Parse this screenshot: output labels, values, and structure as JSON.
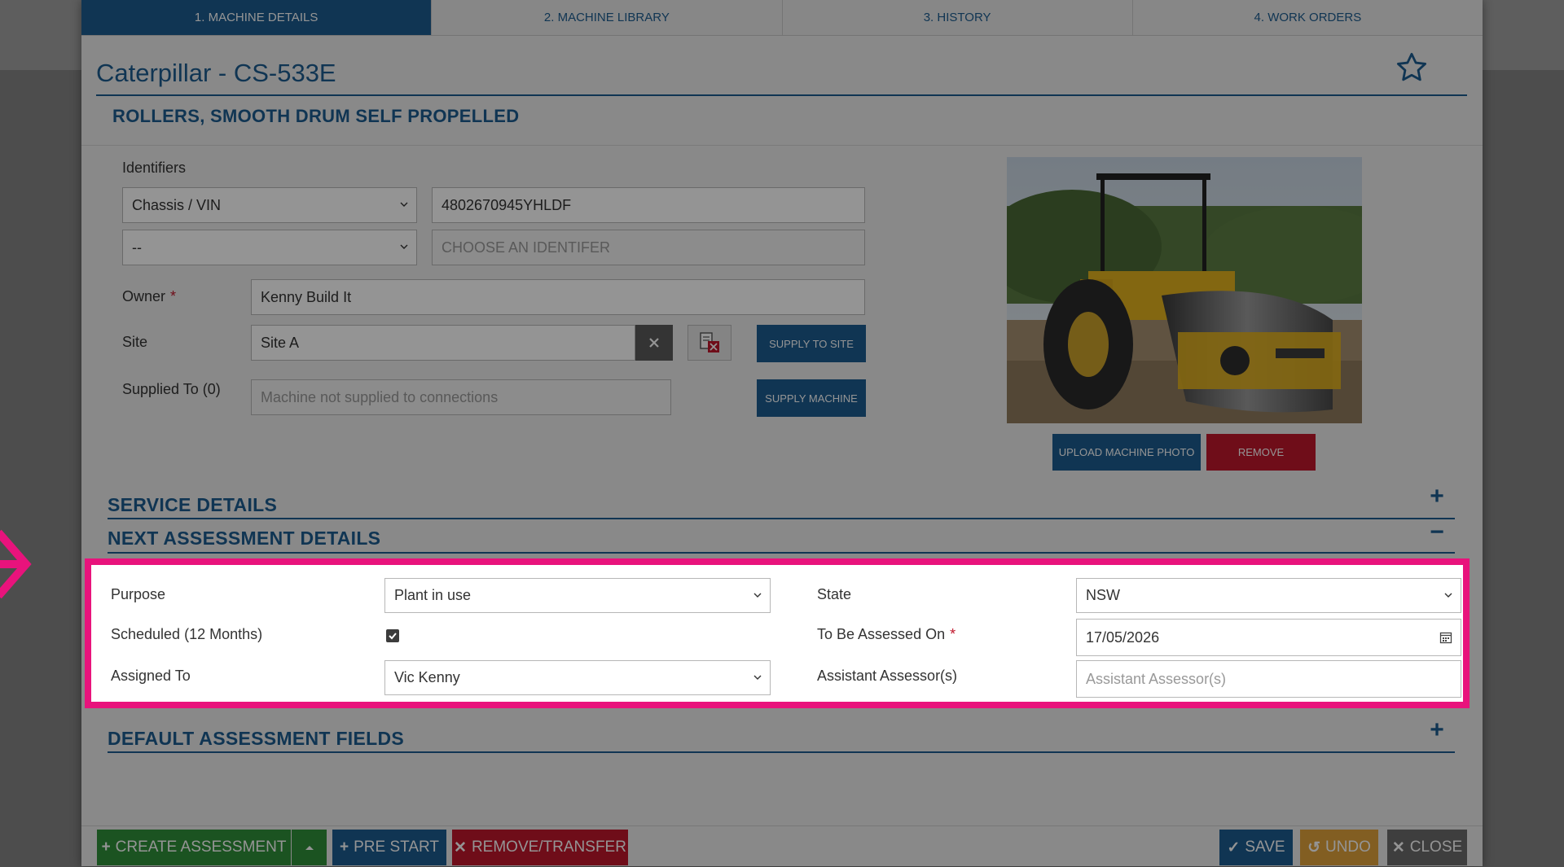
{
  "tabs": [
    {
      "label": "1. MACHINE DETAILS",
      "active": true
    },
    {
      "label": "2. MACHINE LIBRARY",
      "active": false
    },
    {
      "label": "3. HISTORY",
      "active": false
    },
    {
      "label": "4. WORK ORDERS",
      "active": false
    }
  ],
  "machine": {
    "title": "Caterpillar - CS-533E",
    "category": "ROLLERS, SMOOTH DRUM SELF PROPELLED"
  },
  "identifiers": {
    "label": "Identifiers",
    "type1": "Chassis / VIN",
    "value1": "4802670945YHLDF",
    "type2": "--",
    "value2_placeholder": "CHOOSE AN IDENTIFER"
  },
  "owner": {
    "label": "Owner",
    "required": "*",
    "value": "Kenny Build It"
  },
  "site": {
    "label": "Site",
    "value": "Site A",
    "supply_button": "SUPPLY TO SITE"
  },
  "supplied": {
    "label": "Supplied To (0)",
    "placeholder": "Machine not supplied to connections",
    "supply_button": "SUPPLY MACHINE"
  },
  "photo": {
    "upload_button": "UPLOAD MACHINE PHOTO",
    "remove_button": "REMOVE"
  },
  "sections": {
    "service": "SERVICE DETAILS",
    "next_assessment": "NEXT ASSESSMENT DETAILS",
    "default_fields": "DEFAULT ASSESSMENT FIELDS"
  },
  "assessment": {
    "purpose_label": "Purpose",
    "purpose_value": "Plant in use",
    "scheduled_label": "Scheduled (12 Months)",
    "scheduled_checked": true,
    "assigned_label": "Assigned To",
    "assigned_value": "Vic Kenny",
    "state_label": "State",
    "state_value": "NSW",
    "assessed_on_label": "To Be Assessed On",
    "assessed_on_required": "*",
    "assessed_on_value": "17/05/2026",
    "assistant_label": "Assistant Assessor(s)",
    "assistant_placeholder": "Assistant Assessor(s)"
  },
  "footer": {
    "create_assessment": "CREATE ASSESSMENT",
    "pre_start": "PRE START",
    "remove_transfer": "REMOVE/TRANSFER",
    "save": "SAVE",
    "undo": "UNDO",
    "close": "CLOSE"
  },
  "colors": {
    "primary": "#1d5c8f",
    "danger": "#c0172c",
    "success": "#2f8f3a",
    "highlight": "#e8137c",
    "warning": "#e0a23b",
    "neutral": "#6b6b6b"
  }
}
